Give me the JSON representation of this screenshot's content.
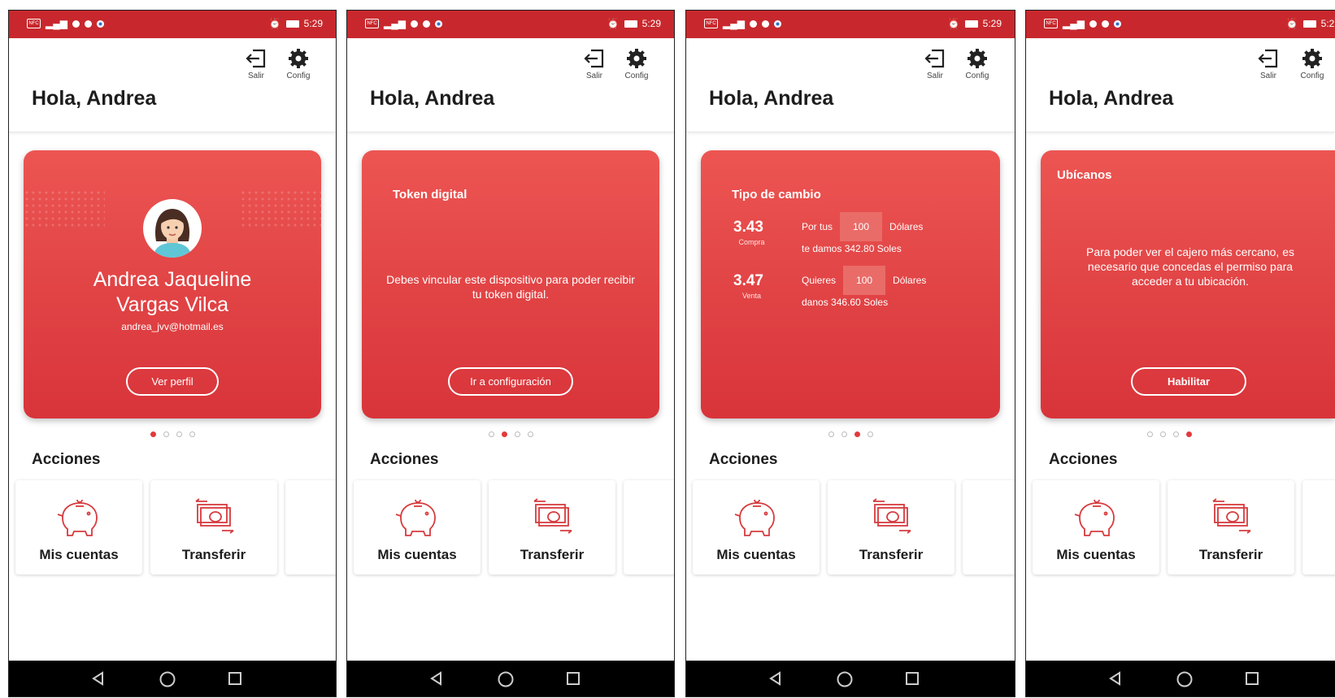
{
  "status_bar": {
    "time": "5:29"
  },
  "header": {
    "greeting": "Hola, Andrea",
    "logout_label": "Salir",
    "config_label": "Config"
  },
  "screens": [
    {
      "card": {
        "name_line1": "Andrea Jaqueline",
        "name_line2": "Vargas Vilca",
        "email": "andrea_jvv@hotmail.es",
        "button": "Ver perfil"
      },
      "active_page": 1
    },
    {
      "card": {
        "title": "Token digital",
        "message": "Debes vincular este dispositivo para poder recibir tu token digital.",
        "button": "Ir a configuración"
      },
      "active_page": 2
    },
    {
      "card": {
        "title": "Tipo de cambio",
        "buy": {
          "rate": "3.43",
          "label": "Compra",
          "prefix": "Por tus",
          "amount": "100",
          "currency": "Dólares",
          "result": "te damos 342.80 Soles"
        },
        "sell": {
          "rate": "3.47",
          "label": "Venta",
          "prefix": "Quieres",
          "amount": "100",
          "currency": "Dólares",
          "result": "danos 346.60 Soles"
        }
      },
      "active_page": 3
    },
    {
      "card": {
        "title": "Ubícanos",
        "message": "Para poder ver el cajero más cercano, es necesario que concedas el permiso para acceder a tu ubicación.",
        "button": "Habilitar"
      },
      "active_page": 4
    }
  ],
  "actions": {
    "title": "Acciones",
    "items": [
      "Mis cuentas",
      "Transferir"
    ]
  },
  "colors": {
    "brand_red": "#c8282d",
    "card_red": "#e5474a",
    "page_dot": "#e23a3c"
  },
  "icons": {
    "logout": "logout-icon",
    "config": "gear-icon",
    "accounts": "piggy-bank-icon",
    "transfer": "money-transfer-icon",
    "back": "back-triangle-icon",
    "home": "home-circle-icon",
    "recent": "recent-square-icon"
  }
}
